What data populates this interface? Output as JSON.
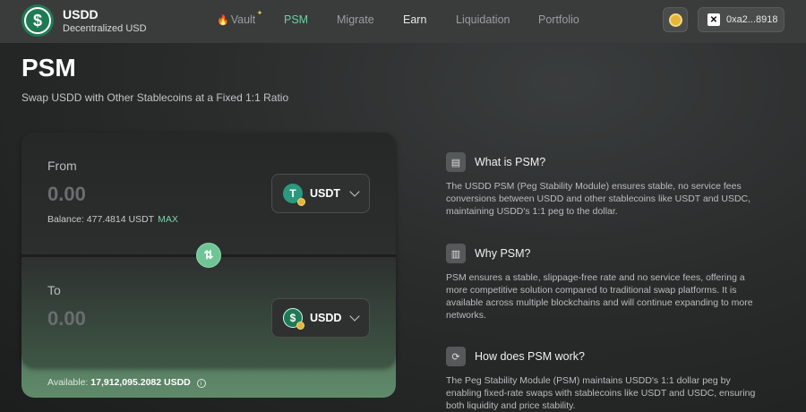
{
  "nav": {
    "brand_title": "USDD",
    "brand_sub": "Decentralized USD",
    "items": [
      {
        "label": "Vault"
      },
      {
        "label": "PSM"
      },
      {
        "label": "Migrate"
      },
      {
        "label": "Earn"
      },
      {
        "label": "Liquidation"
      },
      {
        "label": "Portfolio"
      }
    ],
    "wallet_address": "0xa2...8918"
  },
  "page": {
    "title": "PSM",
    "subtitle": "Swap USDD with Other Stablecoins at a Fixed 1:1 Ratio"
  },
  "swap": {
    "from_label": "From",
    "from_amount_placeholder": "0.00",
    "from_token": "USDT",
    "balance_text": "Balance: 477.4814 USDT",
    "max_label": "MAX",
    "to_label": "To",
    "to_amount_placeholder": "0.00",
    "to_token": "USDD",
    "available_label": "Available:",
    "available_value": "17,912,095.2082 USDD"
  },
  "info": [
    {
      "title": "What is PSM?",
      "text": "The USDD PSM (Peg Stability Module) ensures stable, no service fees conversions between USDD and other stablecoins like USDT and USDC, maintaining USDD's 1:1 peg to the dollar."
    },
    {
      "title": "Why PSM?",
      "text": "PSM ensures a stable, slippage-free rate and no service fees, offering a more competitive solution compared to traditional swap platforms. It is available across multiple blockchains and will continue expanding to more networks."
    },
    {
      "title": "How does PSM work?",
      "text": "The Peg Stability Module (PSM) maintains USDD's 1:1 dollar peg by enabling fixed-rate swaps with stablecoins like USDT and USDC, ensuring both liquidity and price stability."
    }
  ],
  "colors": {
    "accent": "#6fd0a0",
    "brand_green": "#1f7a54"
  }
}
